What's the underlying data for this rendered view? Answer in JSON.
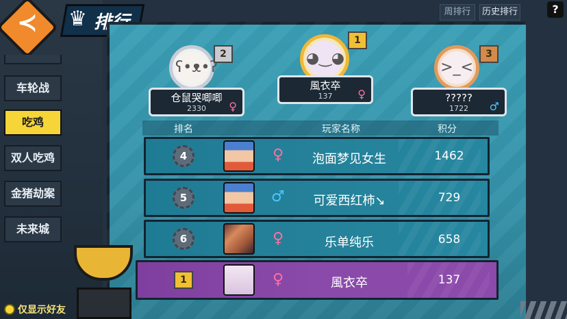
{
  "header": {
    "title": "排行",
    "tabs": [
      "周排行",
      "历史排行"
    ],
    "help": "?"
  },
  "sidebar": {
    "items": [
      {
        "label": "车轮战",
        "active": false
      },
      {
        "label": "吃鸡",
        "active": true
      },
      {
        "label": "双人吃鸡",
        "active": false
      },
      {
        "label": "金猪劫案",
        "active": false
      },
      {
        "label": "未来城",
        "active": false
      }
    ]
  },
  "podium": {
    "first": {
      "rank": "1",
      "name": "風衣卒",
      "score": "137",
      "gender": "♀"
    },
    "second": {
      "rank": "2",
      "name": "仓鼠哭唧唧",
      "score": "2330",
      "gender": "♀"
    },
    "third": {
      "rank": "3",
      "name": "?????",
      "score": "1722",
      "gender": "♂"
    }
  },
  "list_header": {
    "rank": "排名",
    "player": "玩家名称",
    "score": "积分"
  },
  "rows": [
    {
      "rank": "4",
      "name": "泡面梦见女生",
      "score": "1462",
      "gender": "♀"
    },
    {
      "rank": "5",
      "name": "可爱西红柿↘",
      "score": "729",
      "gender": "♂"
    },
    {
      "rank": "6",
      "name": "乐单纯乐",
      "score": "658",
      "gender": "♀"
    }
  ],
  "my_row": {
    "rank": "1",
    "name": "風衣卒",
    "score": "137",
    "gender": "♀"
  },
  "footer": {
    "friends_only": "仅显示好友"
  },
  "colors": {
    "panel": "#3a9fb6",
    "me_row": "#8a4aaa",
    "female": "#ff6fa0",
    "male": "#49c6ff",
    "active_tab": "#f6d538"
  }
}
